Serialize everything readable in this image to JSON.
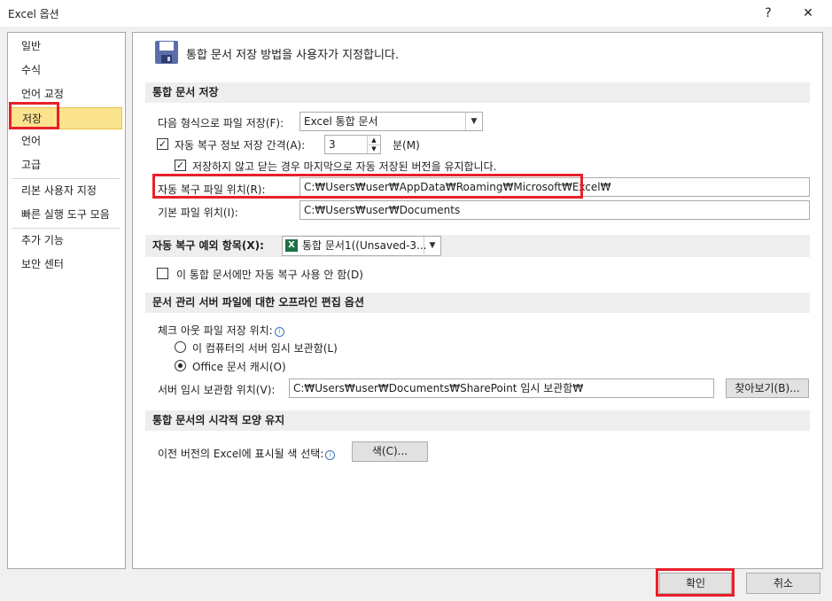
{
  "window": {
    "title": "Excel 옵션",
    "help": "?",
    "close": "✕"
  },
  "sidebar": {
    "items": [
      {
        "label": "일반"
      },
      {
        "label": "수식"
      },
      {
        "label": "언어 교정"
      },
      {
        "label": "저장"
      },
      {
        "label": "언어"
      },
      {
        "label": "고급"
      },
      {
        "label": "리본 사용자 지정"
      },
      {
        "label": "빠른 실행 도구 모음"
      },
      {
        "label": "추가 기능"
      },
      {
        "label": "보안 센터"
      }
    ],
    "selected": "저장"
  },
  "header": {
    "text": "통합 문서 저장 방법을 사용자가 지정합니다."
  },
  "section_save": {
    "title": "통합 문서 저장",
    "format_label": "다음 형식으로 파일 저장(F):",
    "format_value": "Excel 통합 문서",
    "autorecover_checked": true,
    "autorecover_label": "자동 복구 정보 저장 간격(A):",
    "interval_value": "3",
    "minutes_label": "분(M)",
    "keep_checked": true,
    "keep_label": "저장하지 않고 닫는 경우 마지막으로 자동 저장된 버전을 유지합니다.",
    "ar_location_label": "자동 복구 파일 위치(R):",
    "ar_location_value": "C:₩Users₩user₩AppData₩Roaming₩Microsoft₩Excel₩",
    "default_location_label": "기본 파일 위치(I):",
    "default_location_value": "C:₩Users₩user₩Documents"
  },
  "section_exceptions": {
    "title": "자동 복구 예외 항목(X):",
    "workbook_value": "통합 문서1((Unsaved-3...",
    "disable_checked": false,
    "disable_label": "이 통합 문서에만 자동 복구 사용 안 함(D)"
  },
  "section_offline": {
    "title": "문서 관리 서버 파일에 대한 오프라인 편집 옵션",
    "checkout_label": "체크 아웃 파일 저장 위치:",
    "radio1_label": "이 컴퓨터의 서버 임시 보관함(L)",
    "radio2_label": "Office 문서 캐시(O)",
    "selected_radio": "Office 문서 캐시(O)",
    "drafts_label": "서버 임시 보관함 위치(V):",
    "drafts_value": "C:₩Users₩user₩Documents₩SharePoint 임시 보관함₩",
    "browse_label": "찾아보기(B)..."
  },
  "section_visual": {
    "title": "통합 문서의 시각적 모양 유지",
    "color_label": "이전 버전의 Excel에 표시될 색 선택:",
    "color_button": "색(C)..."
  },
  "footer": {
    "ok": "확인",
    "cancel": "취소"
  },
  "colors": {
    "highlight": "#e8202a",
    "selected_nav": "#fbe38d",
    "section_bg": "#eeeeee"
  }
}
